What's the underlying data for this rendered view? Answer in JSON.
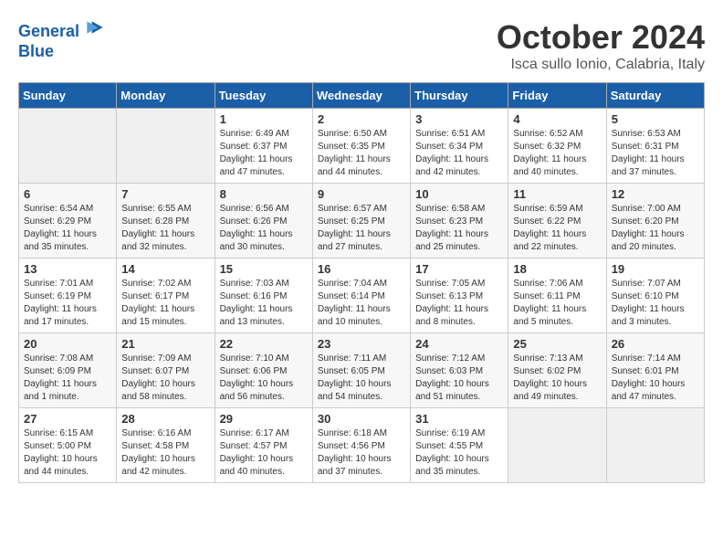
{
  "header": {
    "logo_line1": "General",
    "logo_line2": "Blue",
    "month": "October 2024",
    "location": "Isca sullo Ionio, Calabria, Italy"
  },
  "days_of_week": [
    "Sunday",
    "Monday",
    "Tuesday",
    "Wednesday",
    "Thursday",
    "Friday",
    "Saturday"
  ],
  "weeks": [
    [
      {
        "day": "",
        "info": ""
      },
      {
        "day": "",
        "info": ""
      },
      {
        "day": "1",
        "info": "Sunrise: 6:49 AM\nSunset: 6:37 PM\nDaylight: 11 hours and 47 minutes."
      },
      {
        "day": "2",
        "info": "Sunrise: 6:50 AM\nSunset: 6:35 PM\nDaylight: 11 hours and 44 minutes."
      },
      {
        "day": "3",
        "info": "Sunrise: 6:51 AM\nSunset: 6:34 PM\nDaylight: 11 hours and 42 minutes."
      },
      {
        "day": "4",
        "info": "Sunrise: 6:52 AM\nSunset: 6:32 PM\nDaylight: 11 hours and 40 minutes."
      },
      {
        "day": "5",
        "info": "Sunrise: 6:53 AM\nSunset: 6:31 PM\nDaylight: 11 hours and 37 minutes."
      }
    ],
    [
      {
        "day": "6",
        "info": "Sunrise: 6:54 AM\nSunset: 6:29 PM\nDaylight: 11 hours and 35 minutes."
      },
      {
        "day": "7",
        "info": "Sunrise: 6:55 AM\nSunset: 6:28 PM\nDaylight: 11 hours and 32 minutes."
      },
      {
        "day": "8",
        "info": "Sunrise: 6:56 AM\nSunset: 6:26 PM\nDaylight: 11 hours and 30 minutes."
      },
      {
        "day": "9",
        "info": "Sunrise: 6:57 AM\nSunset: 6:25 PM\nDaylight: 11 hours and 27 minutes."
      },
      {
        "day": "10",
        "info": "Sunrise: 6:58 AM\nSunset: 6:23 PM\nDaylight: 11 hours and 25 minutes."
      },
      {
        "day": "11",
        "info": "Sunrise: 6:59 AM\nSunset: 6:22 PM\nDaylight: 11 hours and 22 minutes."
      },
      {
        "day": "12",
        "info": "Sunrise: 7:00 AM\nSunset: 6:20 PM\nDaylight: 11 hours and 20 minutes."
      }
    ],
    [
      {
        "day": "13",
        "info": "Sunrise: 7:01 AM\nSunset: 6:19 PM\nDaylight: 11 hours and 17 minutes."
      },
      {
        "day": "14",
        "info": "Sunrise: 7:02 AM\nSunset: 6:17 PM\nDaylight: 11 hours and 15 minutes."
      },
      {
        "day": "15",
        "info": "Sunrise: 7:03 AM\nSunset: 6:16 PM\nDaylight: 11 hours and 13 minutes."
      },
      {
        "day": "16",
        "info": "Sunrise: 7:04 AM\nSunset: 6:14 PM\nDaylight: 11 hours and 10 minutes."
      },
      {
        "day": "17",
        "info": "Sunrise: 7:05 AM\nSunset: 6:13 PM\nDaylight: 11 hours and 8 minutes."
      },
      {
        "day": "18",
        "info": "Sunrise: 7:06 AM\nSunset: 6:11 PM\nDaylight: 11 hours and 5 minutes."
      },
      {
        "day": "19",
        "info": "Sunrise: 7:07 AM\nSunset: 6:10 PM\nDaylight: 11 hours and 3 minutes."
      }
    ],
    [
      {
        "day": "20",
        "info": "Sunrise: 7:08 AM\nSunset: 6:09 PM\nDaylight: 11 hours and 1 minute."
      },
      {
        "day": "21",
        "info": "Sunrise: 7:09 AM\nSunset: 6:07 PM\nDaylight: 10 hours and 58 minutes."
      },
      {
        "day": "22",
        "info": "Sunrise: 7:10 AM\nSunset: 6:06 PM\nDaylight: 10 hours and 56 minutes."
      },
      {
        "day": "23",
        "info": "Sunrise: 7:11 AM\nSunset: 6:05 PM\nDaylight: 10 hours and 54 minutes."
      },
      {
        "day": "24",
        "info": "Sunrise: 7:12 AM\nSunset: 6:03 PM\nDaylight: 10 hours and 51 minutes."
      },
      {
        "day": "25",
        "info": "Sunrise: 7:13 AM\nSunset: 6:02 PM\nDaylight: 10 hours and 49 minutes."
      },
      {
        "day": "26",
        "info": "Sunrise: 7:14 AM\nSunset: 6:01 PM\nDaylight: 10 hours and 47 minutes."
      }
    ],
    [
      {
        "day": "27",
        "info": "Sunrise: 6:15 AM\nSunset: 5:00 PM\nDaylight: 10 hours and 44 minutes."
      },
      {
        "day": "28",
        "info": "Sunrise: 6:16 AM\nSunset: 4:58 PM\nDaylight: 10 hours and 42 minutes."
      },
      {
        "day": "29",
        "info": "Sunrise: 6:17 AM\nSunset: 4:57 PM\nDaylight: 10 hours and 40 minutes."
      },
      {
        "day": "30",
        "info": "Sunrise: 6:18 AM\nSunset: 4:56 PM\nDaylight: 10 hours and 37 minutes."
      },
      {
        "day": "31",
        "info": "Sunrise: 6:19 AM\nSunset: 4:55 PM\nDaylight: 10 hours and 35 minutes."
      },
      {
        "day": "",
        "info": ""
      },
      {
        "day": "",
        "info": ""
      }
    ]
  ]
}
